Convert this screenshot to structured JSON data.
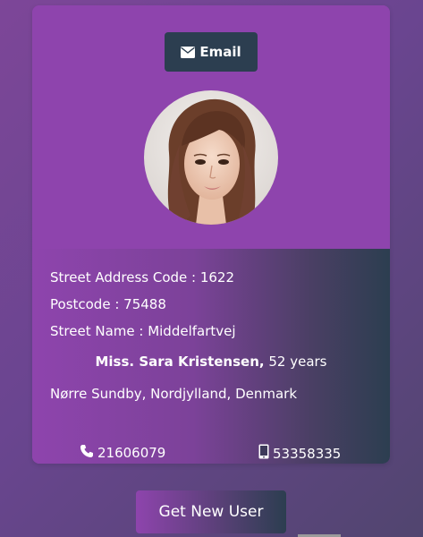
{
  "email_button": {
    "label": "Email",
    "icon": "envelope-icon"
  },
  "avatar": {
    "alt": "profile photo"
  },
  "details": {
    "street_code": "Street Address Code : 1622",
    "postcode": "Postcode : 75488",
    "street_name": "Street Name : Middelfartvej",
    "name_bold": "Miss. Sara Kristensen,",
    "age": " 52 years",
    "location": "Nørre Sundby, Nordjylland, Denmark"
  },
  "phones": {
    "phone": "21606079",
    "cell": "53358335",
    "phone_icon": "phone-icon",
    "cell_icon": "mobile-icon"
  },
  "action_button": {
    "label": "Get New User"
  },
  "colors": {
    "card": "#8e44ad",
    "dark": "#2c3e50"
  }
}
